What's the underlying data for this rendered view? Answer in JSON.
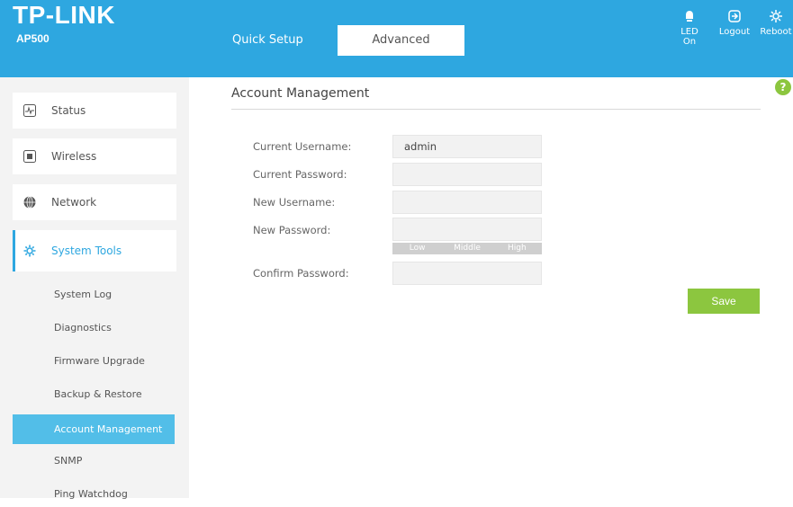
{
  "brand": {
    "logo": "TP-LINK",
    "model": "AP500"
  },
  "tabs": [
    {
      "label": "Quick Setup",
      "active": false
    },
    {
      "label": "Advanced",
      "active": true
    }
  ],
  "header_buttons": {
    "led": "LED On",
    "logout": "Logout",
    "reboot": "Reboot"
  },
  "sidebar": {
    "menu": [
      {
        "label": "Status",
        "icon": "status-icon"
      },
      {
        "label": "Wireless",
        "icon": "wireless-icon"
      },
      {
        "label": "Network",
        "icon": "network-icon"
      },
      {
        "label": "System Tools",
        "icon": "system-tools-icon",
        "active": true
      }
    ],
    "submenu": [
      {
        "label": "System Log"
      },
      {
        "label": "Diagnostics"
      },
      {
        "label": "Firmware Upgrade"
      },
      {
        "label": "Backup & Restore"
      },
      {
        "label": "Account Management",
        "selected": true
      },
      {
        "label": "SNMP"
      },
      {
        "label": "Ping Watchdog"
      }
    ]
  },
  "main": {
    "title": "Account Management",
    "help": "?",
    "fields": {
      "current_username": {
        "label": "Current Username:",
        "value": "admin"
      },
      "current_password": {
        "label": "Current Password:",
        "value": ""
      },
      "new_username": {
        "label": "New Username:",
        "value": ""
      },
      "new_password": {
        "label": "New Password:",
        "value": ""
      },
      "confirm_password": {
        "label": "Confirm Password:",
        "value": ""
      }
    },
    "strength": [
      "Low",
      "Middle",
      "High"
    ],
    "save_label": "Save"
  },
  "colors": {
    "brand_blue": "#2ea7e0",
    "selected_blue": "#52bee8",
    "save_green": "#8cc63f"
  }
}
